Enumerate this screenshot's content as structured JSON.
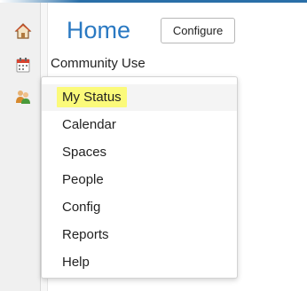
{
  "header": {
    "title": "Home",
    "configure_label": "Configure"
  },
  "left_rail": {
    "icons": [
      "home-icon",
      "calendar-icon",
      "people-icon"
    ]
  },
  "menu": {
    "header_label": "Community Use",
    "items": [
      {
        "label": "My Status",
        "highlighted": true
      },
      {
        "label": "Calendar"
      },
      {
        "label": "Spaces"
      },
      {
        "label": "People"
      },
      {
        "label": "Config"
      },
      {
        "label": "Reports"
      },
      {
        "label": "Help"
      }
    ]
  },
  "colors": {
    "title": "#2a79c2",
    "highlight": "#fbfa7a",
    "accent_bar": "#2a6fa8"
  }
}
